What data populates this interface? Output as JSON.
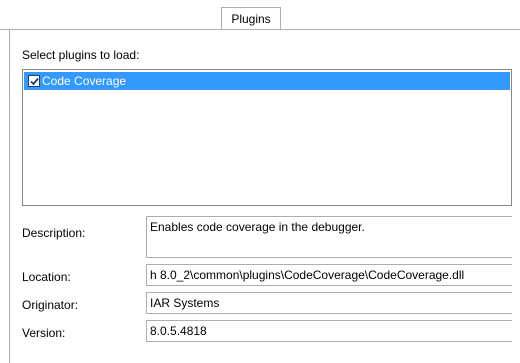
{
  "tabs": [
    {
      "label": "Plugins"
    }
  ],
  "plugins_section": {
    "label": "Select plugins to load:"
  },
  "plugins": [
    {
      "label": "Code Coverage",
      "checked": true,
      "selected": true
    }
  ],
  "details": {
    "description": {
      "label": "Description:",
      "value": "Enables code coverage in the debugger."
    },
    "location": {
      "label": "Location:",
      "value": "h 8.0_2\\common\\plugins\\CodeCoverage\\CodeCoverage.dll"
    },
    "originator": {
      "label": "Originator:",
      "value": "IAR Systems"
    },
    "version": {
      "label": "Version:",
      "value": "8.0.5.4818"
    }
  },
  "colors": {
    "selection": "#3399ff",
    "border": "#adadad"
  }
}
